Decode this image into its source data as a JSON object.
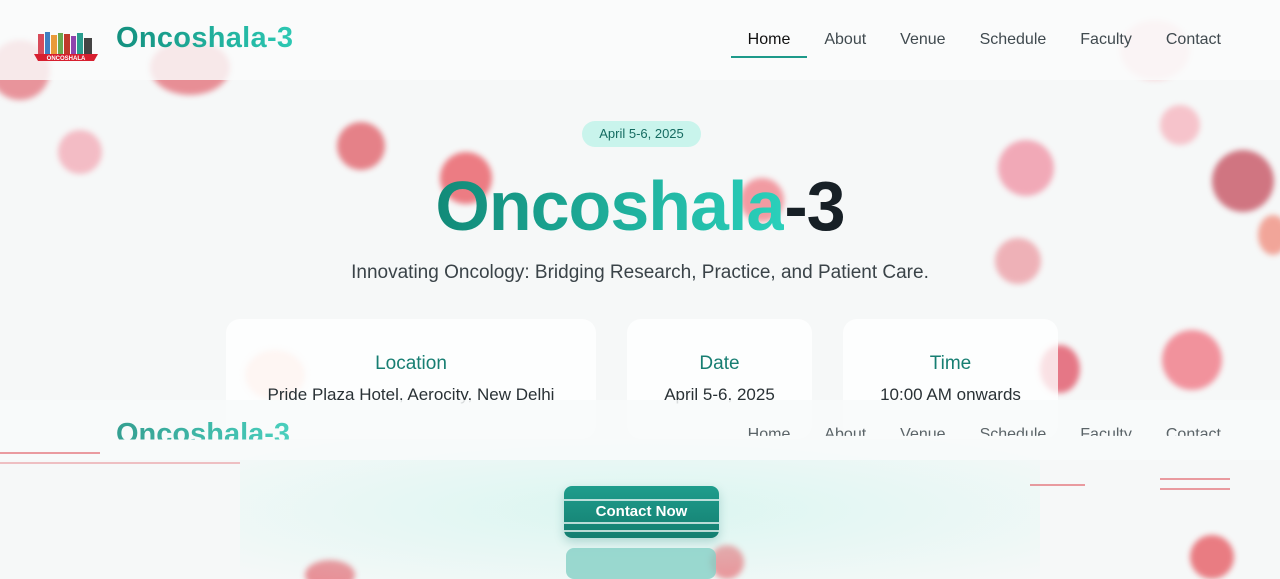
{
  "nav": {
    "logo_caption": "ONCOSHALA",
    "brand": "Oncoshala-3",
    "links": [
      "Home",
      "About",
      "Venue",
      "Schedule",
      "Faculty",
      "Contact"
    ],
    "active": "Home"
  },
  "hero": {
    "badge": "April 5-6, 2025",
    "title_part1": "Oncoshala",
    "title_part2": "-3",
    "tagline": "Innovating Oncology: Bridging Research, Practice, and Patient Care.",
    "cards": [
      {
        "heading": "Location",
        "value": "Pride Plaza Hotel, Aerocity, New Delhi"
      },
      {
        "heading": "Date",
        "value": "April 5-6, 2025"
      },
      {
        "heading": "Time",
        "value": "10:00 AM onwards"
      }
    ],
    "cta": "Contact Now"
  },
  "colors": {
    "accent": "#1d9a8a",
    "badge_bg": "#c9f4ec",
    "blob_red": "#e0525c"
  }
}
